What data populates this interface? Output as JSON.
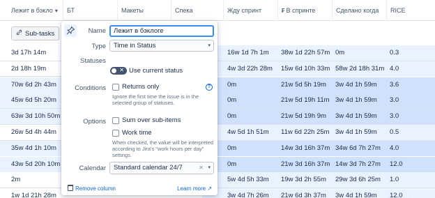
{
  "headers": [
    {
      "label": "Лежит в бэкло",
      "sort": "▾"
    },
    {
      "label": "БТ"
    },
    {
      "label": "Макеты"
    },
    {
      "label": "Спека"
    },
    {
      "label": "Жду спринт"
    },
    {
      "label": "В спринте",
      "flag": "₣"
    },
    {
      "label": "Сделано когда"
    },
    {
      "label": "RICE"
    }
  ],
  "toolbar": {
    "subtasks_label": "Sub-tasks",
    "subtasks_icon": "link-icon"
  },
  "rows": [
    {
      "backlog": "3d 17h 14m",
      "wait": "16w 1d 7h 1m",
      "sprint": "38w 1d 22h 57m",
      "done": "0m",
      "rice": "0.3"
    },
    {
      "backlog": "2d 18h 19m",
      "wait": "4w 3d 22h 28m",
      "sprint": "15w 6d 10h 33m",
      "done": "58w 2d 18h 31m",
      "rice": "4.0"
    },
    {
      "backlog": "70w 6d 2h 43m",
      "wait": "0m",
      "sprint": "21w 5d 5h 19m",
      "done": "3w 4d 1h 59m",
      "rice": "3.6"
    },
    {
      "backlog": "45w 6d 5h 20m",
      "wait": "0m",
      "sprint": "21w 5d 19h 11m",
      "done": "3w 4d 1h 59m",
      "rice": "3.0"
    },
    {
      "backlog": "63w 3d 10h 50m",
      "wait": "0m",
      "sprint": "21w 5d 19h 9m",
      "done": "3w 4d 1h 59m",
      "rice": "3.0"
    },
    {
      "backlog": "26w 5d 4h 44m",
      "wait": "4w 5d 1h 51m",
      "sprint": "11w 6d 22h 25m",
      "done": "3w 4d 1h 59m",
      "rice": "0.5"
    },
    {
      "backlog": "35w 4d 1h 10m",
      "wait": "0m",
      "sprint": "14w 3d 16h 37m",
      "done": "34w 6d 7h 27m",
      "rice": "4.0"
    },
    {
      "backlog": "43w 5d 20h 10m",
      "wait": "0m",
      "sprint": "21w 3d 16h 37m",
      "done": "14w 3d 7h 27m",
      "rice": "12.0"
    },
    {
      "backlog": "2m",
      "wait": "5w 4d 5h 33m",
      "sprint": "19w 3d 2h 55m",
      "done": "29w 3d 6h 25m",
      "rice": "1.0"
    },
    {
      "backlog": "1w 1d 21h 28m",
      "wait": "3w 4d 7h 26m",
      "sprint": "21w 6d 3h 37m",
      "done": "3w 4d 1h 59m",
      "rice": "12.0"
    }
  ],
  "popover": {
    "name_label": "Name",
    "name_value": "Лежит в бэклоге",
    "type_label": "Type",
    "type_value": "Time in Status",
    "statuses_label": "Statuses",
    "use_current_status": "Use current status",
    "conditions_label": "Conditions",
    "returns_only": "Returns only",
    "returns_hint": "Ignore the first time the issue is in the selected group of statuses.",
    "options_label": "Options",
    "sum_over": "Sum over sub-items",
    "work_time": "Work time",
    "work_hint": "When checked, the value will be interpreted according to Jira's \"work hours per day\" settings.",
    "calendar_label": "Calendar",
    "calendar_value": "Standard calendar 24/7",
    "remove_column": "Remove column",
    "learn_more": "Learn more ↗",
    "help_glyph": "?",
    "clear_glyph": "✕",
    "caret_glyph": "▾",
    "toggle_glyph": "✕"
  },
  "colors": {
    "accent": "#0c66e4",
    "selected_row": "#cfe1fd",
    "selected_cell": "#e9f2ff"
  }
}
